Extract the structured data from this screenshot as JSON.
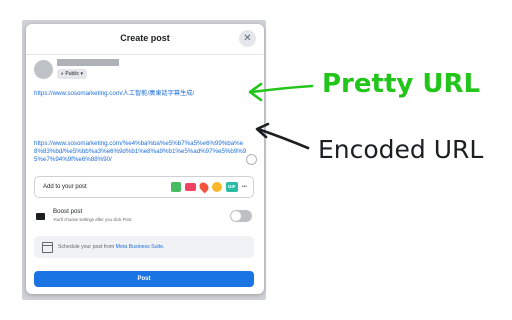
{
  "dialog": {
    "title": "Create post",
    "privacy": "Public",
    "pretty_url": "https://www.sosomarketing.com/人工智能/廣東話字幕生成/",
    "encoded_url": "https://www.sosomarketing.com/%e4%ba%ba%e5%b7%a5%e6%99%ba%e8%83%bd/%e5%bb%a3%e6%9d%b1%e8%a9%b1%e5%ad%97%e5%b9%95%e7%94%9f%e6%88%90/",
    "add_label": "Add to your post",
    "add_icons": [
      "photo-icon",
      "video-icon",
      "location-icon",
      "emoji-icon",
      "gif-icon",
      "more-icon"
    ],
    "gif_label": "GIF",
    "more_label": "•••",
    "boost_title": "Boost post",
    "boost_sub": "You'll choose settings after you click Post.",
    "boost_enabled": false,
    "schedule_text": "Schedule your post from ",
    "schedule_link": "Meta Business Suite",
    "schedule_end": ".",
    "post_label": "Post"
  },
  "annotations": {
    "pretty_label": "Pretty URL",
    "encoded_label": "Encoded URL",
    "pretty_color": "#22c51a",
    "encoded_color": "#1c1e21"
  },
  "colors": {
    "link": "#216fdb",
    "post_button": "#1b74e4"
  }
}
